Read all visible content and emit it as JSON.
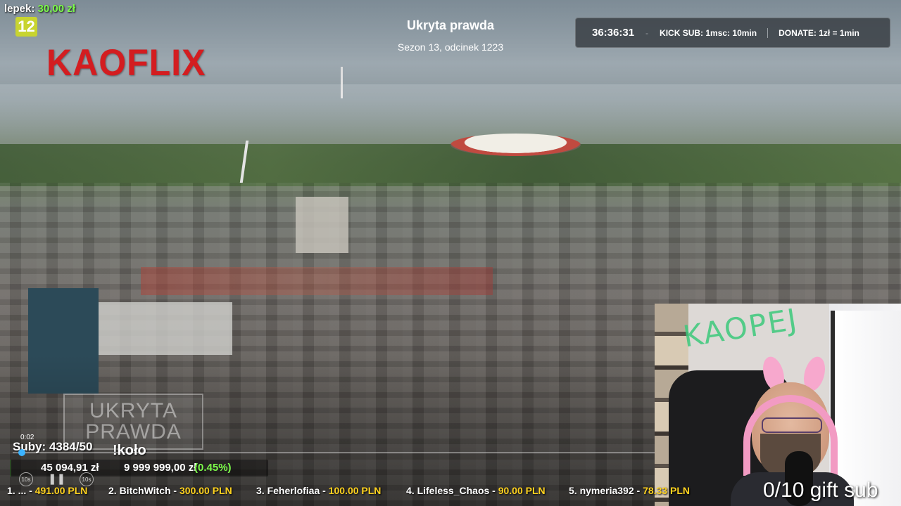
{
  "channel": {
    "user_label": "lepek:",
    "user_amount": "30,00 zł",
    "age_badge": "12",
    "logo": "KAOFLIX"
  },
  "episode": {
    "show_title": "Ukryta prawda",
    "episode_info": "Sezon 13, odcinek 1223"
  },
  "timer": {
    "time": "36:36:31",
    "separator": "-",
    "kick_sub": "KICK SUB: 1msc: 10min",
    "donate": "DONATE: 1zł = 1min"
  },
  "overlay": {
    "watermark_line1": "UKRYTA",
    "watermark_line2": "PRAWDA",
    "cam_sign": "KAOPEJ",
    "suby": "Suby: 4384/50",
    "kolo": "!koło",
    "mini_time": "0:02"
  },
  "goal": {
    "raised": "45 094,91 zł",
    "target": "9 999 999,00 zł",
    "percent": "(0.45%)",
    "progress_fraction": 0.0045
  },
  "controls": {
    "rewind_label": "10s",
    "forward_label": "10s",
    "pause_icon": "pause-icon"
  },
  "ticker": [
    {
      "rank": "1.",
      "name": "...",
      "amount": "491.00 PLN"
    },
    {
      "rank": "2.",
      "name": "BitchWitch",
      "amount": "300.00 PLN"
    },
    {
      "rank": "3.",
      "name": "Feherlofiaa",
      "amount": "100.00 PLN"
    },
    {
      "rank": "4.",
      "name": "Lifeless_Chaos",
      "amount": "90.00 PLN"
    },
    {
      "rank": "5.",
      "name": "nymeria392",
      "amount": "78.33 PLN"
    }
  ],
  "ticker_dash": "-",
  "gift_sub": "0/10 gift sub",
  "colors": {
    "accent_green": "#7CFC4A",
    "amount_yellow": "#ffd21f",
    "logo_red": "#d31d20",
    "badge_green": "#c8d430"
  }
}
